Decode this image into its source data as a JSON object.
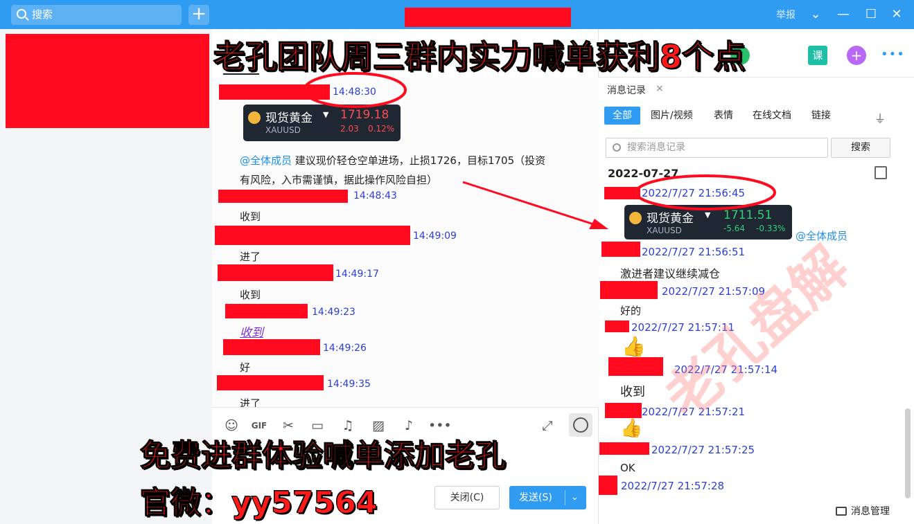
{
  "titlebar": {
    "search_placeholder": "搜索",
    "plus": "+",
    "report": "举报",
    "win_chevron": "⌄",
    "win_min": "—",
    "win_max": "☐",
    "win_close": "✕"
  },
  "overlay": {
    "headline": "老孔团队周三群内实力喊单获利8个点",
    "promo_line1": "免费进群体验喊单添加老孔",
    "promo_line2": "官微：yy57564",
    "watermark": "老孔盘解"
  },
  "chat": {
    "messages": [
      {
        "time": "14:48:30"
      },
      {
        "card": {
          "name": "现货黄金",
          "code": "XAUUSD",
          "price": "1719.18",
          "change": "2.03",
          "change_pct": "0.12%"
        }
      },
      {
        "mention": "@全体成员",
        "text_line1": " 建议现价轻仓空单进场，止损1726，目标1705（投资",
        "text_line2": "有风险，入市需谨慎，据此操作风险自担）"
      },
      {
        "time": "14:48:43",
        "text": "收到"
      },
      {
        "time": "14:49:09",
        "text": "进了"
      },
      {
        "time": "14:49:17",
        "text": "收到"
      },
      {
        "time": "14:49:23",
        "text": "收到"
      },
      {
        "time": "14:49:26",
        "text": "好"
      },
      {
        "time": "14:49:35",
        "text": "进了"
      }
    ],
    "tools": [
      "☺",
      "GIF",
      "✂",
      "▭",
      "♫",
      "▨",
      "♪",
      "•••"
    ],
    "expand_icon": "⤢",
    "close_label": "关闭(C)",
    "send_label": "发送(S)",
    "send_chevron": "⌄"
  },
  "panel": {
    "tab_label": "消息记录",
    "tab_close": "×",
    "filters": [
      "全部",
      "图片/视频",
      "表情",
      "在线文档",
      "链接"
    ],
    "search_placeholder": "搜索消息记录",
    "search_button": "搜索",
    "date": "2022-07-27",
    "card": {
      "name": "现货黄金",
      "code": "XAUUSD",
      "price": "1711.51",
      "change": "-5.64",
      "change_pct": "-0.33%"
    },
    "mention": "@全体成员",
    "entries": [
      {
        "time": "2022/7/27 21:56:45"
      },
      {
        "time": "2022/7/27 21:56:51",
        "text": "激进者建议继续减仓"
      },
      {
        "time": "2022/7/27 21:57:09",
        "text": "好的"
      },
      {
        "time": "2022/7/27 21:57:11",
        "emoji": "👍"
      },
      {
        "time": "2022/7/27 21:57:14",
        "text": "收到"
      },
      {
        "time": "2022/7/27 21:57:21",
        "emoji": "👍"
      },
      {
        "time": "2022/7/27 21:57:25",
        "text": "OK"
      },
      {
        "time": "2022/7/27 21:57:28"
      }
    ],
    "manage_label": "消息管理",
    "course_icon": "课",
    "more_icon": "•••"
  },
  "colors": {
    "accent": "#2f9cf2",
    "redact": "#ff0a1e",
    "timestamp": "#2a3ed3",
    "overlay_text": "#ff1a1a"
  }
}
